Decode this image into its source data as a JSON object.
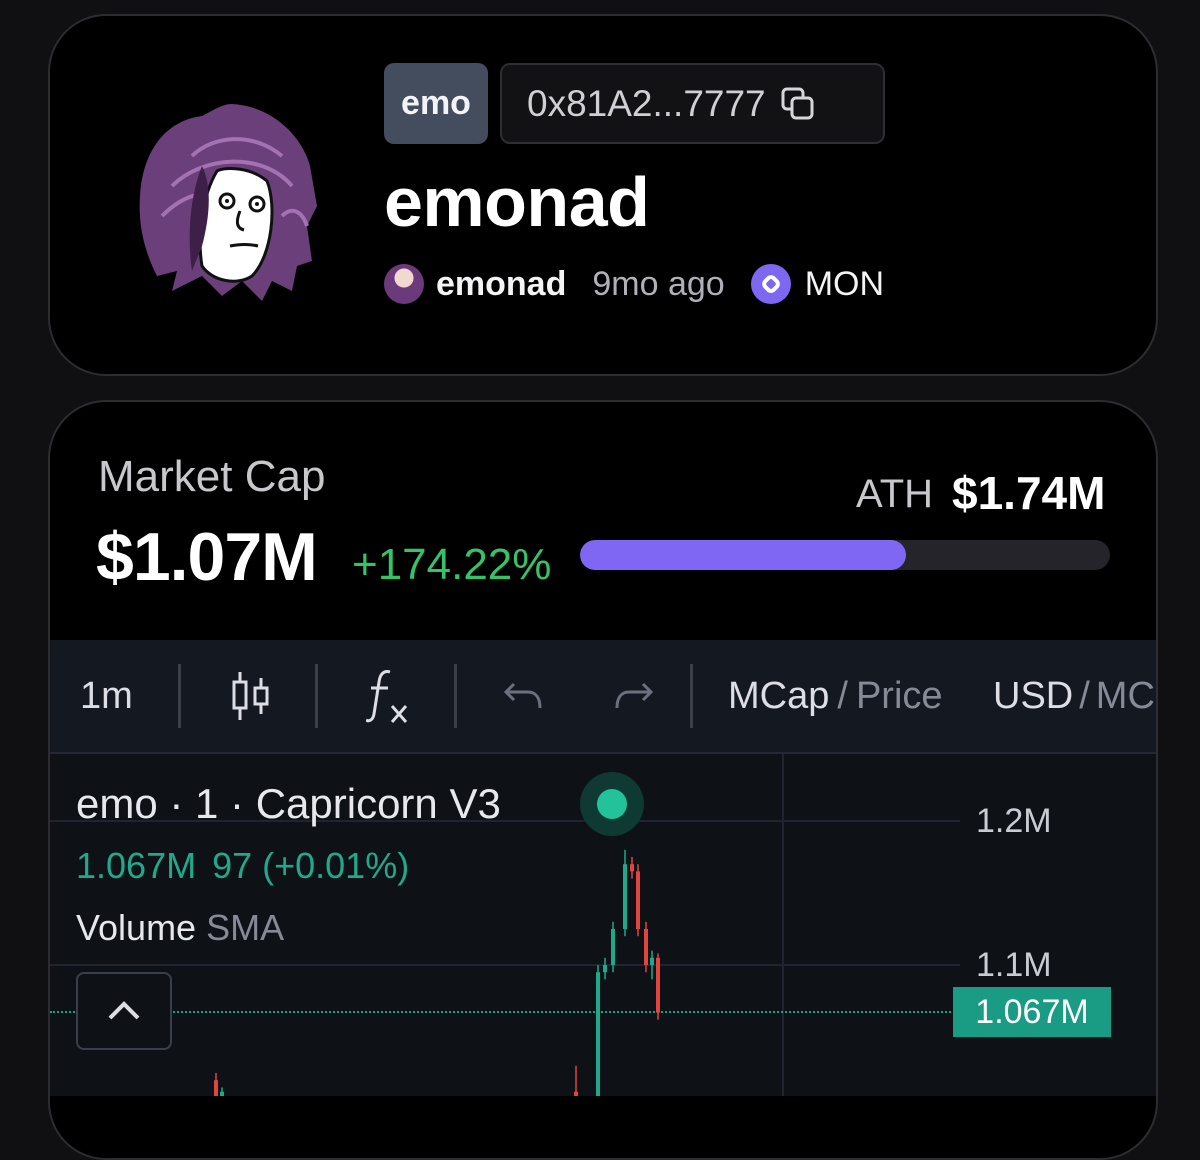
{
  "token": {
    "ticker": "emo",
    "address": "0x81A2...7777",
    "name": "emonad",
    "creator": "emonad",
    "created_ago": "9mo ago",
    "chain": "MON",
    "icons": {
      "copy": "copy-icon",
      "chain": "monad-icon"
    }
  },
  "market": {
    "label": "Market Cap",
    "value": "$1.07M",
    "change": "+174.22%",
    "ath_label": "ATH",
    "ath_value": "$1.74M",
    "ath_progress": 0.615,
    "colors": {
      "up": "#35c36a",
      "progress": "#8067f3"
    }
  },
  "toolbar": {
    "interval": "1m",
    "candle_icon": "candlestick-icon",
    "indicator_icon": "fx-icon",
    "undo_icon": "undo-icon",
    "redo_icon": "redo-icon",
    "mcap": "MCap",
    "slash": "/",
    "price": "Price",
    "usd": "USD",
    "mon_partial": "MC"
  },
  "chart": {
    "title": "emo · 1 · Capricorn V3",
    "values_mcap": "1.067M",
    "values_change": "97 (+0.01%)",
    "volume_label": "Volume",
    "volume_sma": "SMA",
    "axis_labels": [
      "1.2M",
      "1.1M"
    ],
    "last_price": "1.067M",
    "colors": {
      "up": "#1fa98b",
      "down": "#e0463e",
      "status": "#22c39a"
    }
  },
  "chart_data": {
    "type": "candlestick",
    "title": "emo · 1 · Capricorn V3",
    "ylabel": "",
    "y_ticks": [
      "1.2M",
      "1.1M"
    ],
    "last_value": "1.067M",
    "candles": [
      {
        "o": 1.02,
        "h": 1.025,
        "l": 1.0,
        "c": 1.005
      },
      {
        "o": 1.005,
        "h": 1.015,
        "l": 0.99,
        "c": 1.012
      },
      {
        "o": 1.012,
        "h": 1.03,
        "l": 1.0,
        "c": 1.005
      },
      {
        "o": 1.005,
        "h": 1.1,
        "l": 1.0,
        "c": 1.095
      },
      {
        "o": 1.095,
        "h": 1.105,
        "l": 1.09,
        "c": 1.1
      },
      {
        "o": 1.1,
        "h": 1.13,
        "l": 1.095,
        "c": 1.125
      },
      {
        "o": 1.125,
        "h": 1.18,
        "l": 1.12,
        "c": 1.17
      },
      {
        "o": 1.17,
        "h": 1.175,
        "l": 1.16,
        "c": 1.165
      },
      {
        "o": 1.165,
        "h": 1.17,
        "l": 1.12,
        "c": 1.125
      },
      {
        "o": 1.125,
        "h": 1.13,
        "l": 1.095,
        "c": 1.1
      },
      {
        "o": 1.1,
        "h": 1.11,
        "l": 1.09,
        "c": 1.105
      },
      {
        "o": 1.105,
        "h": 1.108,
        "l": 1.062,
        "c": 1.067
      }
    ]
  }
}
